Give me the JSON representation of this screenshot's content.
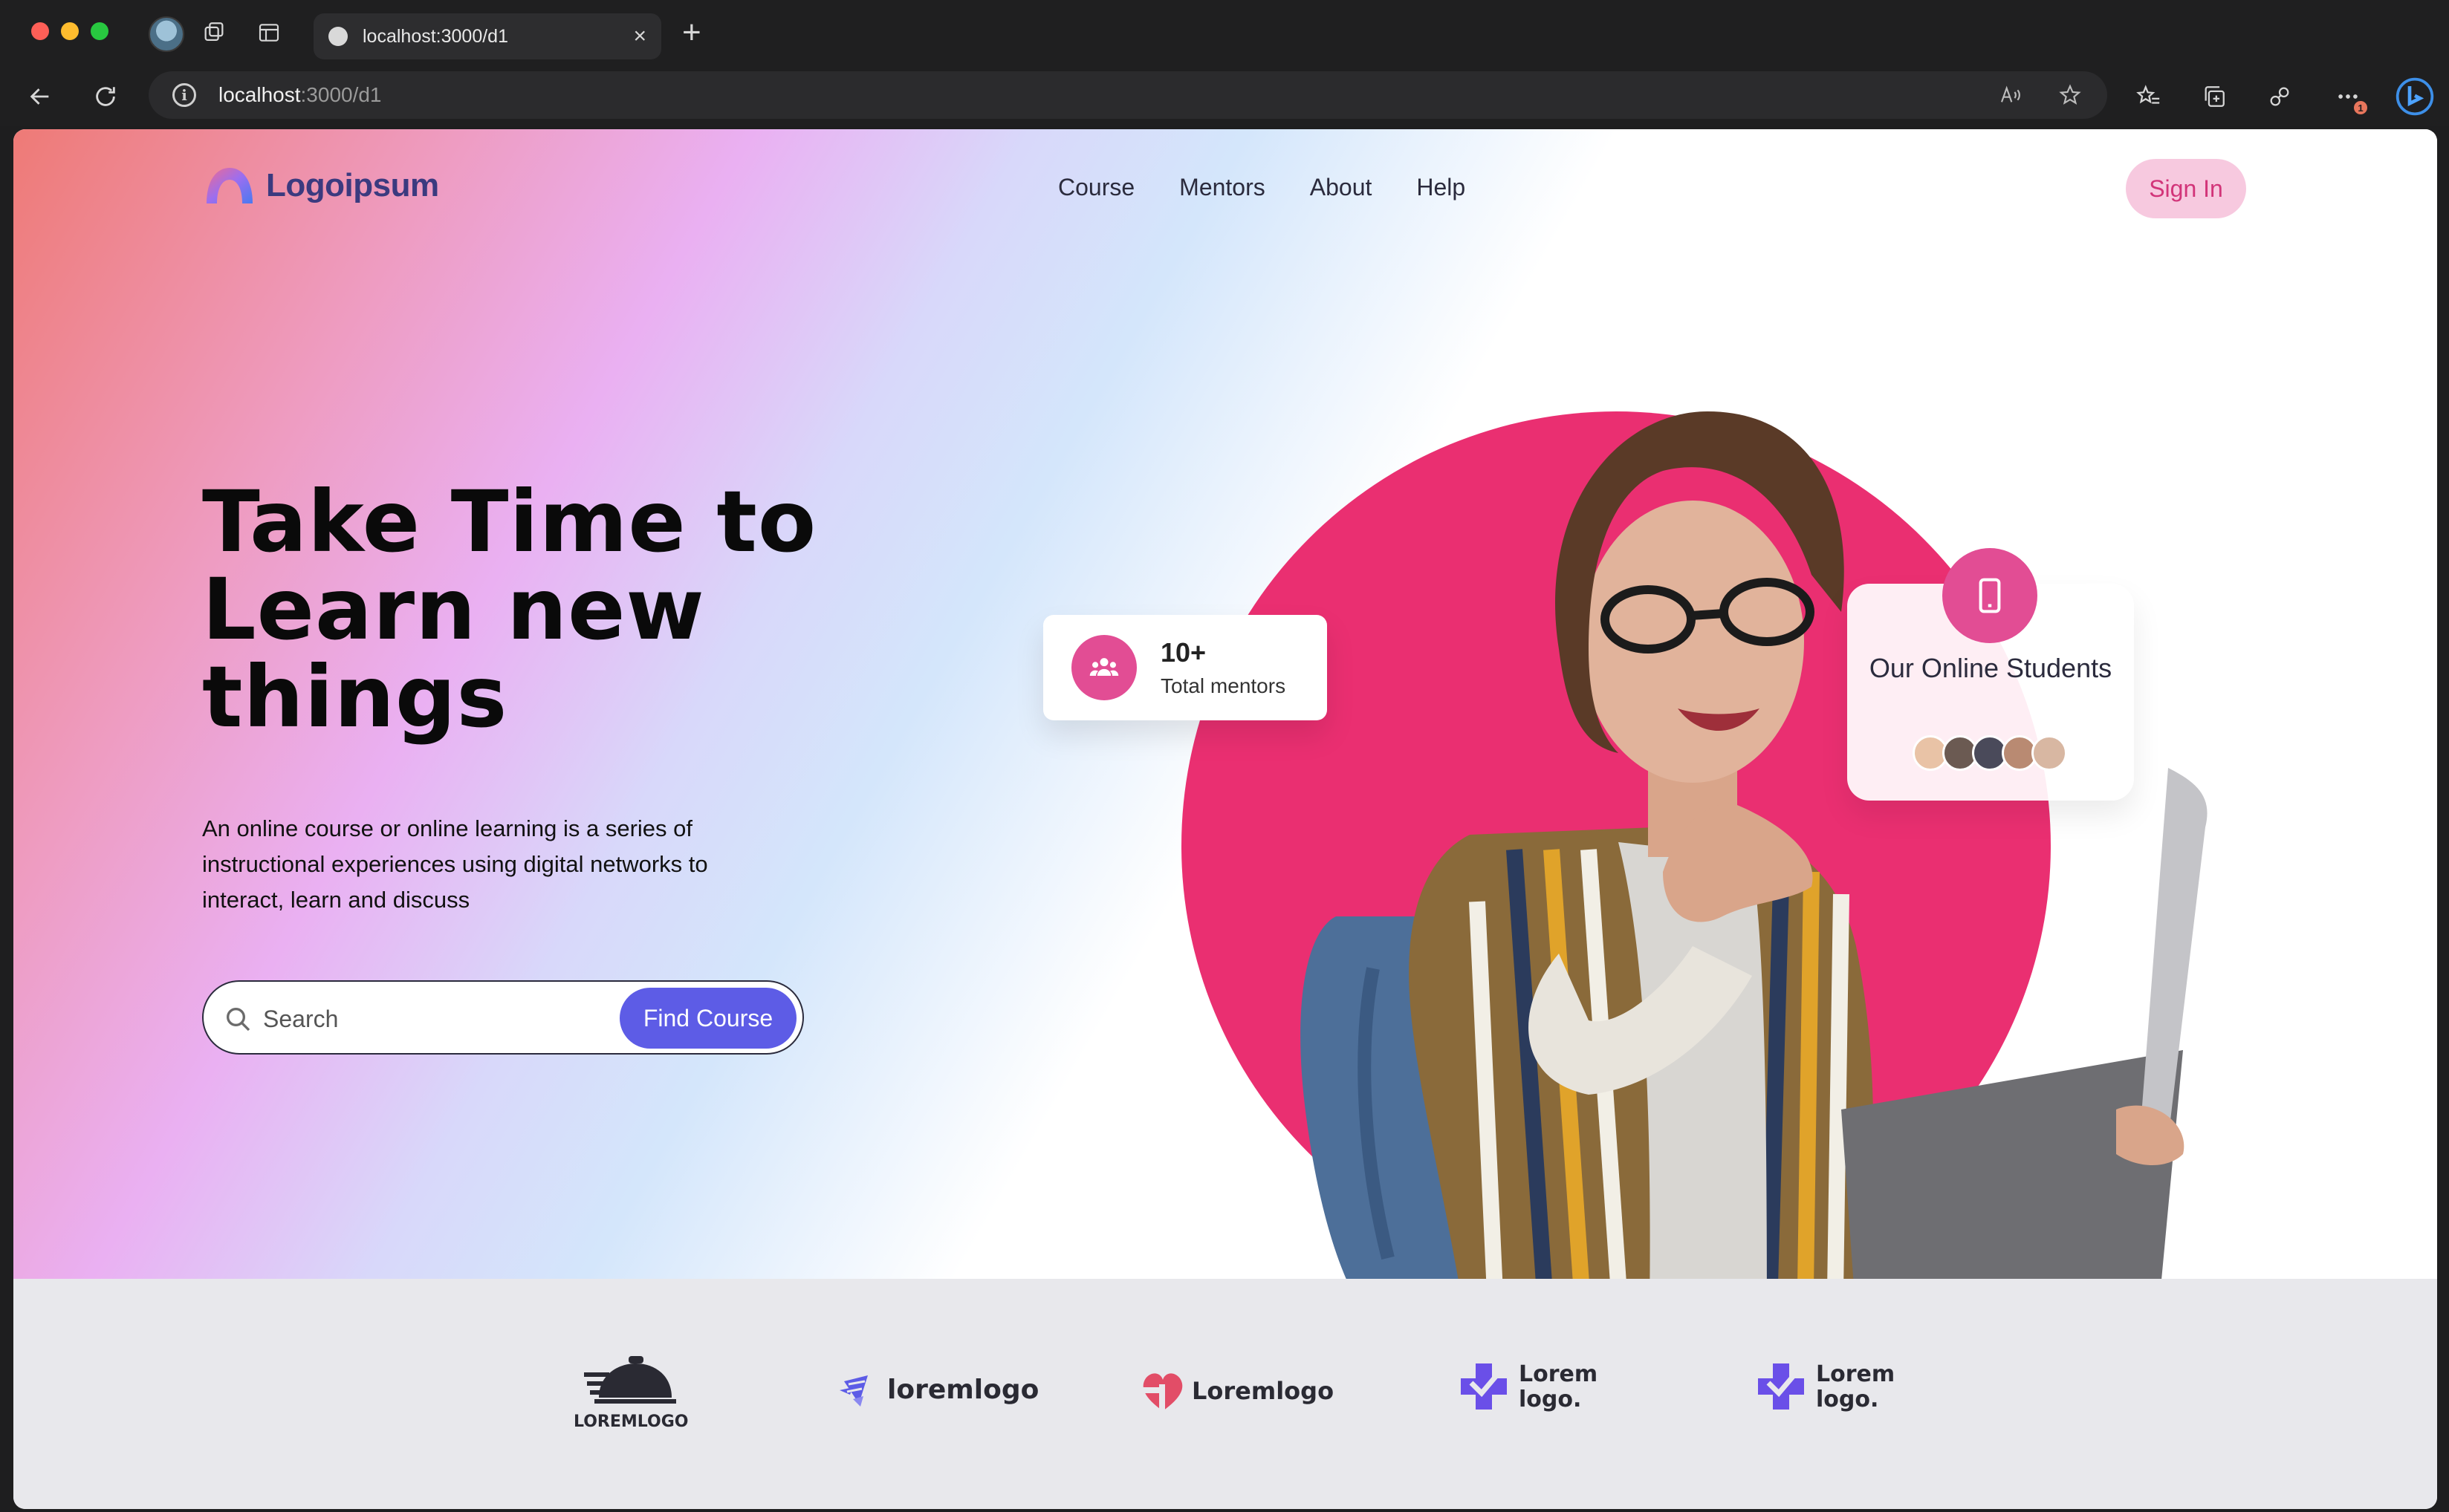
{
  "browser": {
    "tab_title": "localhost:3000/d1",
    "url_host": "localhost",
    "url_path": ":3000/d1",
    "extensions_badge": "1"
  },
  "header": {
    "logo_text": "Logoipsum",
    "nav": [
      "Course",
      "Mentors",
      "About",
      "Help"
    ],
    "signin_label": "Sign In"
  },
  "hero": {
    "headline_lines": [
      "Take Time to",
      "Learn new",
      "things"
    ],
    "description": "An online course or online learning is a series of instructional experiences using digital networks to interact, learn and discuss",
    "search_placeholder": "Search",
    "find_button": "Find Course"
  },
  "stats": {
    "mentors_count": "10+",
    "mentors_label": "Total mentors",
    "students_title": "Our Online Students"
  },
  "partners": [
    {
      "name": "LOREMLOGO"
    },
    {
      "name": "loremlogo"
    },
    {
      "name": "Loremlogo"
    },
    {
      "name": "Lorem logo."
    },
    {
      "name": "Lorem logo."
    }
  ],
  "colors": {
    "brand_pink": "#ea2f71",
    "accent_pink": "#e24d94",
    "primary_button": "#5d5ce6",
    "logo_text": "#3b3a7f"
  }
}
